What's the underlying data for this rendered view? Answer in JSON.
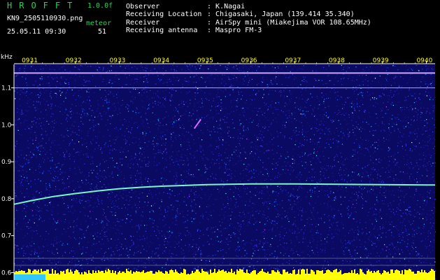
{
  "header": {
    "logo": "HROFFT",
    "version": "1.0.0f",
    "filename": "KN9_2505110930.png",
    "timestamp": "25.05.11 09:30",
    "meteor_label": "meteor",
    "meteor_count": "51",
    "info": [
      {
        "label": "Observer",
        "value": ": K.Nagai"
      },
      {
        "label": "Receiving Location",
        "value": ": Chigasaki, Japan (139.414 35.340)"
      },
      {
        "label": "Receiver",
        "value": ": AirSpy mini (Miakejima VOR 108.65MHz)"
      },
      {
        "label": "Receiving antenna",
        "value": ": Maspro FM-3"
      }
    ]
  },
  "colors": {
    "background": "#000000",
    "accent_green": "#1fd65a",
    "time_labels": "#ffff00",
    "noise_base": "#0a0a62",
    "trace_line": "#7af7c8",
    "meteor": "#d66cff",
    "bottom_bar": "#ffff00"
  },
  "chart_data": {
    "type": "heatmap",
    "title": "",
    "xlabel": "",
    "ylabel": "kHz",
    "x_ticks": [
      "0931",
      "0932",
      "0933",
      "0934",
      "0935",
      "0936",
      "0937",
      "0938",
      "0939",
      "0940"
    ],
    "y_ticks": [
      "1.1",
      "1.0",
      "0.9",
      "0.8",
      "0.7",
      "0.6"
    ],
    "ylim": [
      0.58,
      1.19
    ],
    "xlim": [
      30.6,
      40.2
    ],
    "horizontal_lines_khz": [
      1.14,
      1.1
    ],
    "drift_trace": {
      "x_minutes": [
        30.6,
        31.0,
        31.5,
        32.0,
        32.5,
        33.0,
        33.5,
        34.0,
        34.5,
        35.0,
        35.5,
        36.0,
        37.0,
        38.0,
        39.0,
        40.0,
        40.2
      ],
      "y_khz": [
        0.785,
        0.795,
        0.806,
        0.814,
        0.821,
        0.827,
        0.831,
        0.834,
        0.836,
        0.838,
        0.839,
        0.84,
        0.84,
        0.839,
        0.838,
        0.837,
        0.837
      ]
    },
    "meteor_echo": {
      "x_minutes": [
        34.71,
        34.86
      ],
      "y_khz": [
        0.99,
        1.015
      ]
    },
    "grid": false
  }
}
